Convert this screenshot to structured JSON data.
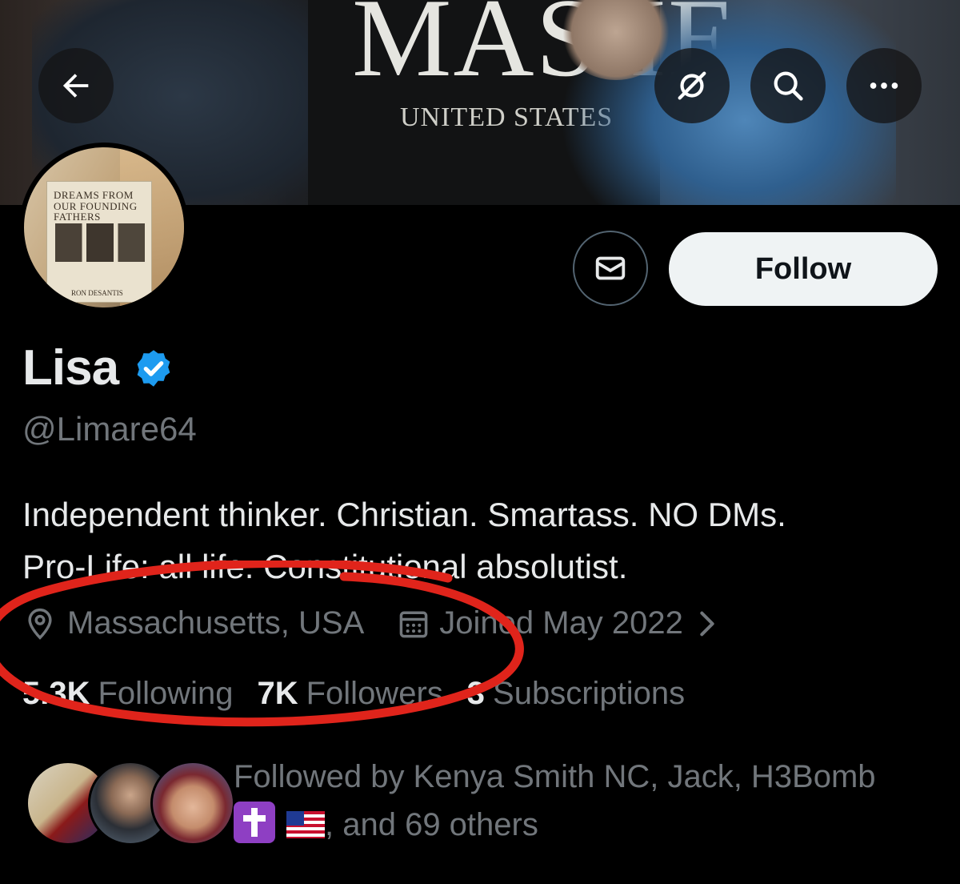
{
  "banner": {
    "sign_text": "MAS IE",
    "sign_subtext": "UNITED STATES"
  },
  "header_icons": {
    "back": "back-arrow-icon",
    "grok": "grok-icon",
    "search": "search-icon",
    "more": "more-icon"
  },
  "avatar": {
    "book_title": "DREAMS FROM OUR FOUNDING FATHERS",
    "book_author": "RON DESANTIS"
  },
  "actions": {
    "message_icon": "envelope-icon",
    "follow_label": "Follow"
  },
  "profile": {
    "display_name": "Lisa",
    "verified": true,
    "handle": "@Limare64",
    "bio_line1": "Independent thinker. Christian. Smartass. NO DMs.",
    "bio_line2": "Pro-Life: all life. Constitutional absolutist.",
    "location": "Massachusetts, USA",
    "joined": "Joined May 2022"
  },
  "stats": {
    "following_count": "5.3K",
    "following_label": "Following",
    "followers_count": "7K",
    "followers_label": "Followers",
    "subscriptions_count": "3",
    "subscriptions_label": "Subscriptions"
  },
  "followed_by": {
    "line1": "Followed by Kenya Smith NC, Jack, H3Bomb",
    "line2_suffix": ", and 69 others"
  },
  "colors": {
    "background": "#000000",
    "text_primary": "#e7e9ea",
    "text_secondary": "#71767b",
    "verified_blue": "#1d9bf0",
    "annotation_red": "#e0241b",
    "follow_button_bg": "#eff3f4"
  }
}
